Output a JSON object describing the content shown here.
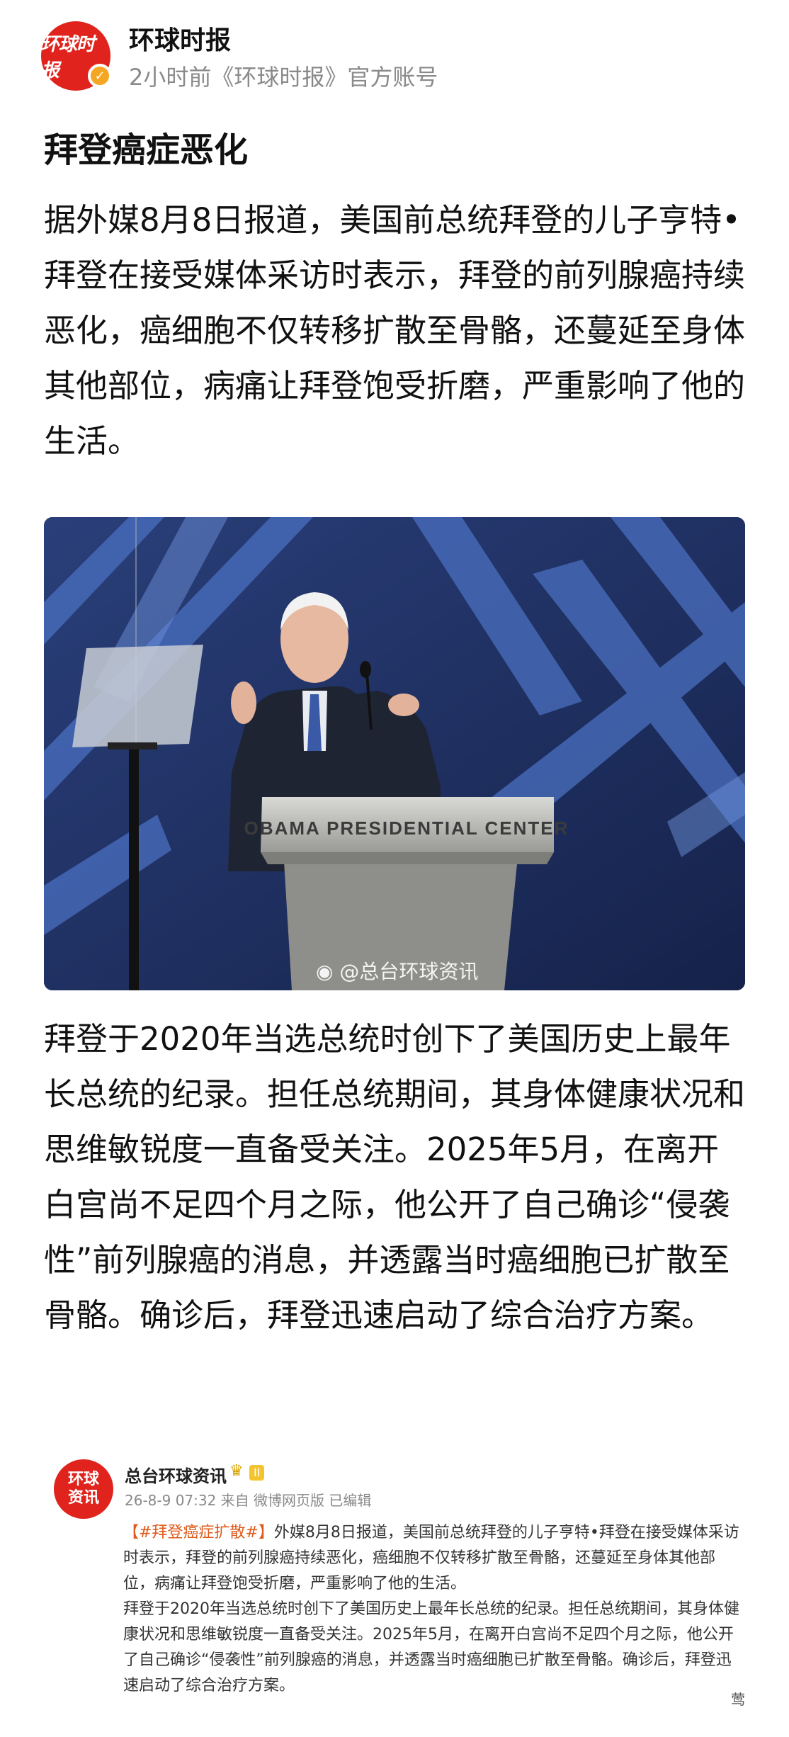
{
  "header": {
    "logo_text": "环球时报",
    "account_name": "环球时报",
    "meta": "2小时前《环球时报》官方账号",
    "verified_icon": "check"
  },
  "article": {
    "title": "拜登癌症恶化",
    "paragraph1": "据外媒8月8日报道，美国前总统拜登的儿子亨特•拜登在接受媒体采访时表示，拜登的前列腺癌持续恶化，癌细胞不仅转移扩散至骨骼，还蔓延至身体其他部位，病痛让拜登饱受折磨，严重影响了他的生活。",
    "paragraph2": "拜登于2020年当选总统时创下了美国历史上最年长总统的纪录。担任总统期间，其身体健康状况和思维敏锐度一直备受关注。2025年5月，在离开白宫尚不足四个月之际，他公开了自己确诊“侵袭性”前列腺癌的消息，并透露当时癌细胞已扩散至骨骼。确诊后，拜登迅速启动了综合治疗方案。"
  },
  "photo": {
    "podium_text": "OBAMA PRESIDENTIAL CENTER",
    "watermark": "@总台环球资讯"
  },
  "embedded_post": {
    "logo_line1": "环球",
    "logo_line2": "资讯",
    "name": "总台环球资讯",
    "badge": "II",
    "meta": "26-8-9 07:32 来自 微博网页版 已编辑",
    "hashtag": "【#拜登癌症扩散#】",
    "body": "外媒8月8日报道，美国前总统拜登的儿子亨特•拜登在接受媒体采访时表示，拜登的前列腺癌持续恶化，癌细胞不仅转移扩散至骨骼，还蔓延至身体其他部位，病痛让拜登饱受折磨，严重影响了他的生活。",
    "body2": "拜登于2020年当选总统时创下了美国历史上最年长总统的纪录。担任总统期间，其身体健康状况和思维敏锐度一直备受关注。2025年5月，在离开白宫尚不足四个月之际，他公开了自己确诊“侵袭性”前列腺癌的消息，并透露当时癌细胞已扩散至骨骼。确诊后，拜登迅速启动了综合治疗方案。",
    "corner_text": "莺"
  },
  "colors": {
    "brand_red": "#e0231c",
    "verified": "#f5a623",
    "meta_gray": "#8a8a8a",
    "hashtag_orange": "#e05a1b"
  }
}
